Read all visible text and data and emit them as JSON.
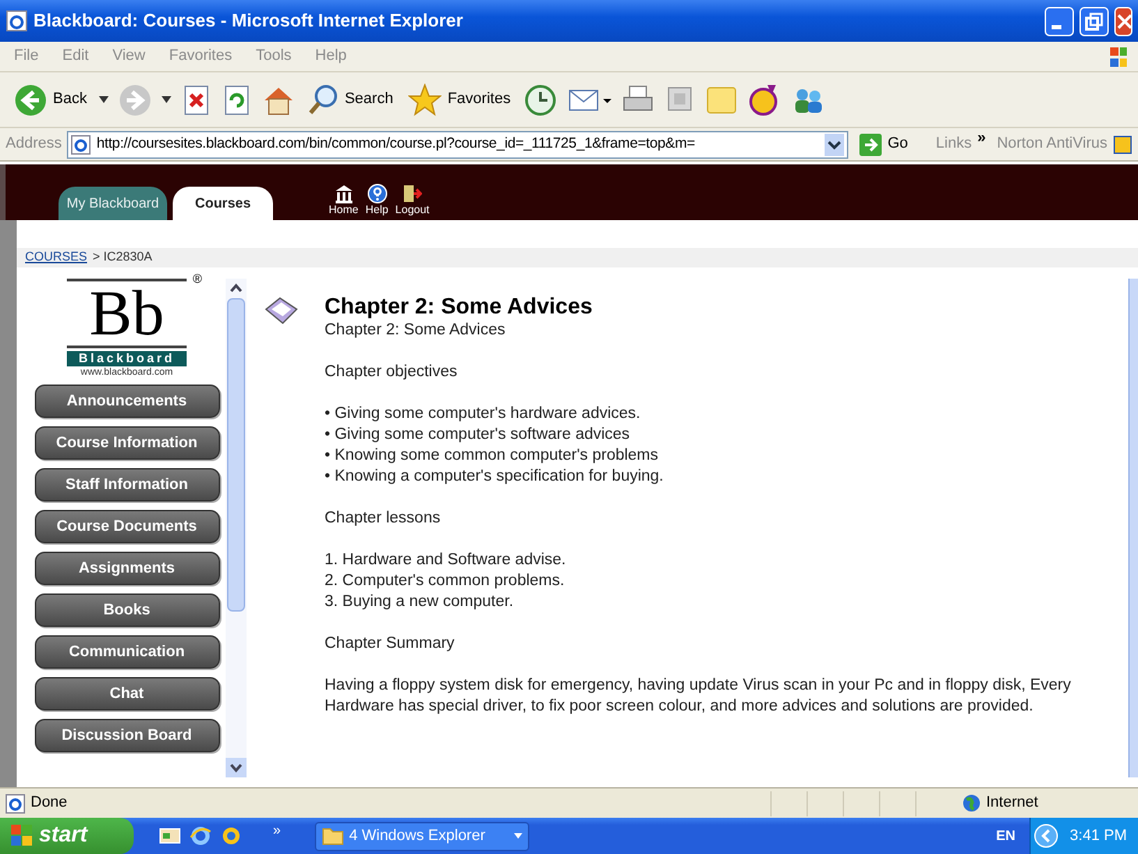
{
  "window": {
    "title": "Blackboard: Courses - Microsoft Internet Explorer"
  },
  "menu_bar": [
    "File",
    "Edit",
    "View",
    "Favorites",
    "Tools",
    "Help"
  ],
  "toolbar": [
    {
      "kind": "back",
      "label": "Back"
    },
    {
      "kind": "forward"
    },
    {
      "kind": "stop"
    },
    {
      "kind": "refresh"
    },
    {
      "kind": "home"
    },
    {
      "kind": "search",
      "label": "Search"
    },
    {
      "kind": "favorites",
      "label": "Favorites"
    },
    {
      "kind": "history"
    },
    {
      "kind": "mail"
    },
    {
      "kind": "print"
    },
    {
      "kind": "edit"
    },
    {
      "kind": "note"
    },
    {
      "kind": "messenger"
    },
    {
      "kind": "people"
    }
  ],
  "address_bar": {
    "label": "Address",
    "url": "http://coursesites.blackboard.com/bin/common/course.pl?course_id=_111725_1&frame=top&m=",
    "go": "Go",
    "links": "Links",
    "chevron": "»",
    "norton": "Norton AntiVirus"
  },
  "tabs": [
    {
      "label": "My Blackboard",
      "selected": false
    },
    {
      "label": "Courses",
      "selected": true
    }
  ],
  "nav_icons": [
    {
      "kind": "home",
      "label": "Home"
    },
    {
      "kind": "help",
      "label": "Help"
    },
    {
      "kind": "logout",
      "label": "Logout"
    }
  ],
  "breadcrumb": {
    "link": "COURSES",
    "current": "> IC2830A"
  },
  "logo": {
    "letters": "Bb",
    "mark": "®",
    "name": "Blackboard",
    "site": "www.blackboard.com"
  },
  "course_menu": [
    "Announcements",
    "Course Information",
    "Staff Information",
    "Course Documents",
    "Assignments",
    "Books",
    "Communication",
    "Chat",
    "Discussion Board"
  ],
  "content": {
    "title": "Chapter 2: Some Advices",
    "subtitle": "Chapter 2: Some Advices",
    "sections": [
      {
        "heading": "Chapter objectives",
        "lines": [
          "• Giving some computer's hardware advices.",
          "• Giving some computer's software advices",
          "• Knowing some common computer's problems",
          "• Knowing a computer's specification for buying."
        ]
      },
      {
        "heading": "Chapter lessons",
        "lines": [
          "1. Hardware and Software advise.",
          "2. Computer's common problems.",
          "3. Buying a new computer."
        ]
      },
      {
        "heading": "Chapter Summary",
        "paragraph": "Having a floppy system disk for emergency, having update Virus scan in your Pc and in floppy disk, Every Hardware has special driver, to fix poor screen colour, and more advices and solutions are provided."
      }
    ]
  },
  "status_bar": {
    "text": "Done",
    "zone": "Internet"
  },
  "taskbar": {
    "start": "start",
    "chevron": "»",
    "windows": [
      "4 Windows Explorer"
    ],
    "language": "EN",
    "clock": "3:41 PM"
  }
}
